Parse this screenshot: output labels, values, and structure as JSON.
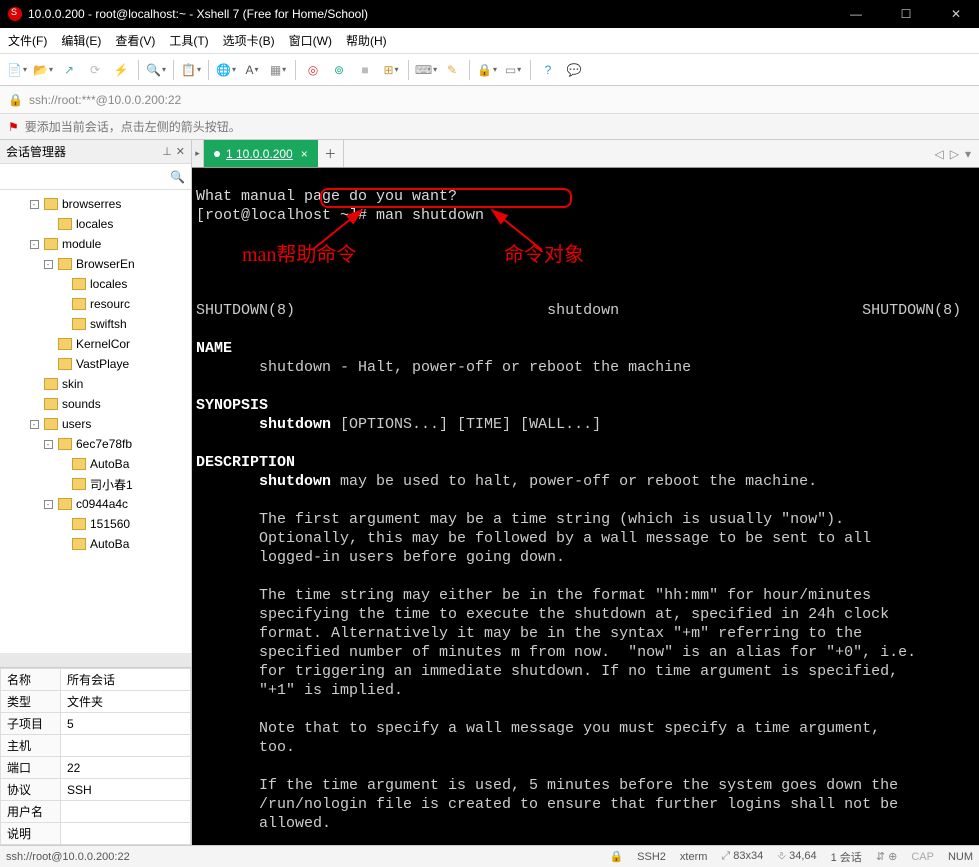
{
  "title": "10.0.0.200 - root@localhost:~ - Xshell 7 (Free for Home/School)",
  "menu": [
    "文件(F)",
    "编辑(E)",
    "查看(V)",
    "工具(T)",
    "选项卡(B)",
    "窗口(W)",
    "帮助(H)"
  ],
  "address": "ssh://root:***@10.0.0.200:22",
  "notification": "要添加当前会话，点击左侧的箭头按钮。",
  "sidebar": {
    "title": "会话管理器",
    "tree": [
      {
        "indent": 2,
        "exp": "-",
        "label": "browserres"
      },
      {
        "indent": 3,
        "exp": "",
        "label": "locales"
      },
      {
        "indent": 2,
        "exp": "-",
        "label": "module"
      },
      {
        "indent": 3,
        "exp": "-",
        "label": "BrowserEn"
      },
      {
        "indent": 4,
        "exp": "",
        "label": "locales"
      },
      {
        "indent": 4,
        "exp": "",
        "label": "resourc"
      },
      {
        "indent": 4,
        "exp": "",
        "label": "swiftsh"
      },
      {
        "indent": 3,
        "exp": "",
        "label": "KernelCor"
      },
      {
        "indent": 3,
        "exp": "",
        "label": "VastPlaye"
      },
      {
        "indent": 2,
        "exp": "",
        "label": "skin"
      },
      {
        "indent": 2,
        "exp": "",
        "label": "sounds"
      },
      {
        "indent": 2,
        "exp": "-",
        "label": "users"
      },
      {
        "indent": 3,
        "exp": "-",
        "label": "6ec7e78fb"
      },
      {
        "indent": 4,
        "exp": "",
        "label": "AutoBa"
      },
      {
        "indent": 4,
        "exp": "",
        "label": "司小春1"
      },
      {
        "indent": 3,
        "exp": "-",
        "label": "c0944a4c"
      },
      {
        "indent": 4,
        "exp": "",
        "label": "151560"
      },
      {
        "indent": 4,
        "exp": "",
        "label": "AutoBa"
      }
    ],
    "props": [
      [
        "名称",
        "所有会话"
      ],
      [
        "类型",
        "文件夹"
      ],
      [
        "子项目",
        "5"
      ],
      [
        "主机",
        ""
      ],
      [
        "端口",
        "22"
      ],
      [
        "协议",
        "SSH"
      ],
      [
        "用户名",
        ""
      ],
      [
        "说明",
        ""
      ]
    ]
  },
  "tab": {
    "label": "1 10.0.0.200"
  },
  "terminal": {
    "line1": "What manual page do you want?",
    "prompt": "[root@localhost ~]# ",
    "cmd": "man shutdown",
    "header_left": "SHUTDOWN(8)",
    "header_mid": "shutdown",
    "header_right": "SHUTDOWN(8)",
    "name_h": "NAME",
    "name_l": "       shutdown - Halt, power-off or reboot the machine",
    "syn_h": "SYNOPSIS",
    "syn_b": "shutdown",
    "syn_r": " [OPTIONS...] [TIME] [WALL...]",
    "desc_h": "DESCRIPTION",
    "desc_b": "shutdown",
    "desc_r": " may be used to halt, power-off or reboot the machine.",
    "p2a": "       The first argument may be a time string (which is usually \"now\").",
    "p2b": "       Optionally, this may be followed by a wall message to be sent to all",
    "p2c": "       logged-in users before going down.",
    "p3a": "       The time string may either be in the format \"hh:mm\" for hour/minutes",
    "p3b": "       specifying the time to execute the shutdown at, specified in 24h clock",
    "p3c": "       format. Alternatively it may be in the syntax \"+m\" referring to the",
    "p3d": "       specified number of minutes m from now.  \"now\" is an alias for \"+0\", i.e.",
    "p3e": "       for triggering an immediate shutdown. If no time argument is specified,",
    "p3f": "       \"+1\" is implied.",
    "p4a": "       Note that to specify a wall message you must specify a time argument,",
    "p4b": "       too.",
    "p5a": "       If the time argument is used, 5 minutes before the system goes down the",
    "p5b": "       /run/nologin file is created to ensure that further logins shall not be",
    "p5c": "       allowed."
  },
  "annotations": {
    "left": "man帮助命令",
    "right": "命令对象"
  },
  "status": {
    "left": "ssh://root@10.0.0.200:22",
    "ssh": "SSH2",
    "term": "xterm",
    "size": "83x34",
    "cur": "34,64",
    "sess": "1 会话",
    "cap": "CAP",
    "num": "NUM"
  }
}
